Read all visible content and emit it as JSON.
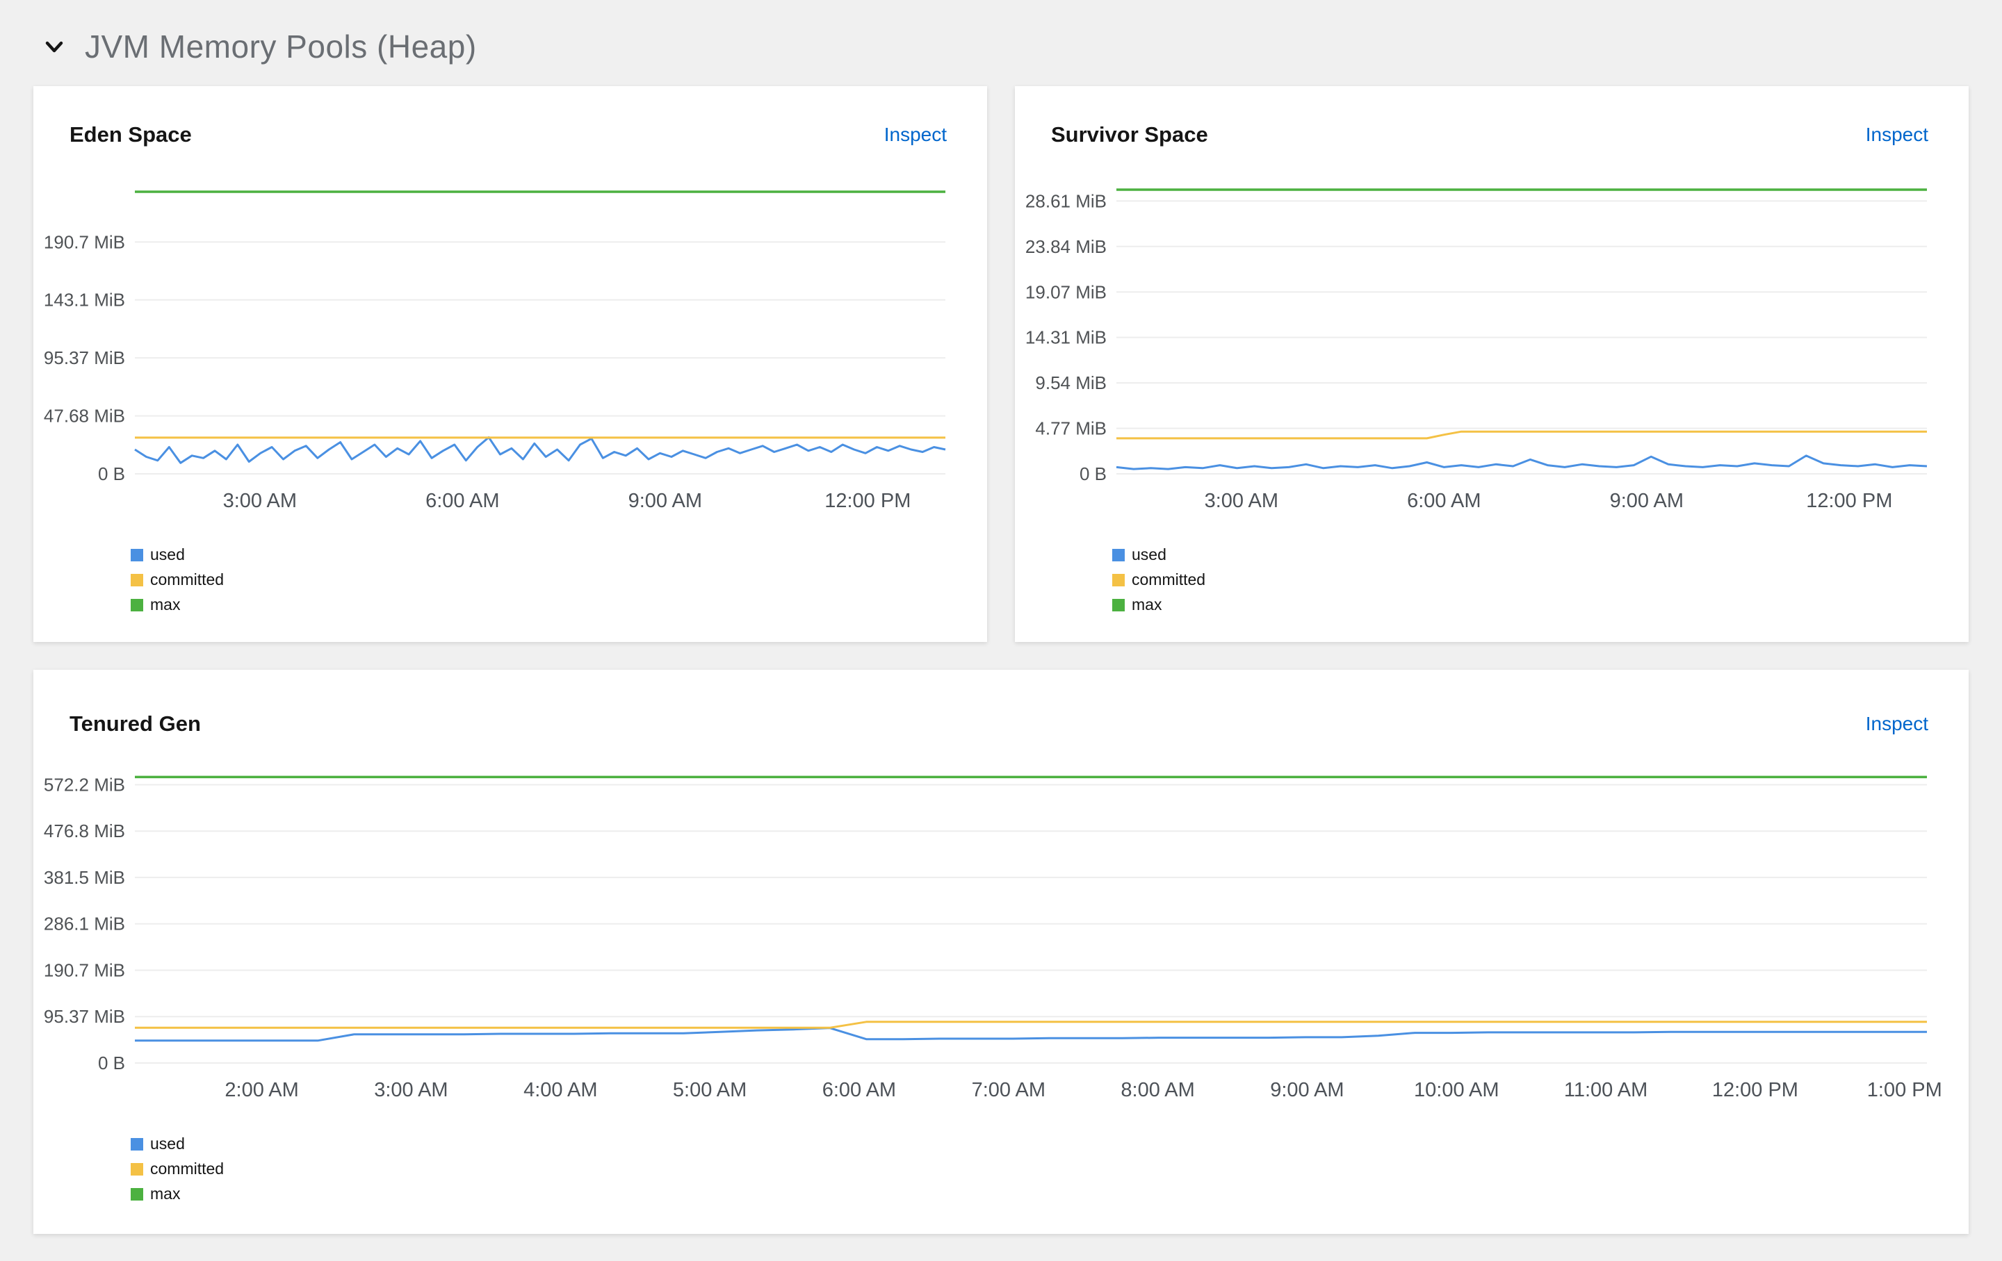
{
  "header": {
    "title": "JVM Memory Pools (Heap)"
  },
  "labels": {
    "inspect": "Inspect"
  },
  "colors": {
    "used": "#4a90e2",
    "committed": "#f4c145",
    "max": "#4cb140",
    "link": "#0066cc",
    "grid": "#ededed"
  },
  "legend": [
    {
      "label": "used",
      "color_key": "used"
    },
    {
      "label": "committed",
      "color_key": "committed"
    },
    {
      "label": "max",
      "color_key": "max"
    }
  ],
  "chart_data": [
    {
      "type": "line",
      "name": "eden-space",
      "title": "Eden Space",
      "x_domain": [
        1.15,
        13.15
      ],
      "y_max": 240,
      "ylabel": "",
      "xlabel": "",
      "grid": true,
      "legend_position": "bottom-left",
      "y_ticks": [
        {
          "value": 0,
          "label": "0 B"
        },
        {
          "value": 47.68,
          "label": "47.68 MiB"
        },
        {
          "value": 95.37,
          "label": "95.37 MiB"
        },
        {
          "value": 143.1,
          "label": "143.1 MiB"
        },
        {
          "value": 190.7,
          "label": "190.7 MiB"
        }
      ],
      "x_ticks": [
        {
          "t": 3,
          "label": "3:00 AM"
        },
        {
          "t": 6,
          "label": "6:00 AM"
        },
        {
          "t": 9,
          "label": "9:00 AM"
        },
        {
          "t": 12,
          "label": "12:00 PM"
        }
      ],
      "series": [
        {
          "name": "used",
          "color_key": "used",
          "values": [
            20,
            14,
            11,
            22,
            9,
            15,
            13,
            19,
            12,
            24,
            10,
            17,
            22,
            12,
            19,
            23,
            13,
            20,
            26,
            12,
            18,
            24,
            14,
            21,
            16,
            27,
            13,
            19,
            24,
            11,
            22,
            30,
            16,
            21,
            12,
            25,
            14,
            20,
            11,
            24,
            29,
            13,
            18,
            15,
            21,
            12,
            17,
            14,
            19,
            16,
            13,
            18,
            21,
            17,
            20,
            23,
            18,
            21,
            24,
            19,
            22,
            18,
            24,
            20,
            17,
            22,
            19,
            23,
            20,
            18,
            22,
            20
          ]
        },
        {
          "name": "committed",
          "color_key": "committed",
          "value": 29.8
        },
        {
          "name": "max",
          "color_key": "max",
          "value": 232
        }
      ]
    },
    {
      "type": "line",
      "name": "survivor-space",
      "title": "Survivor Space",
      "x_domain": [
        1.15,
        13.15
      ],
      "y_max": 30.6,
      "ylabel": "",
      "xlabel": "",
      "grid": true,
      "legend_position": "bottom-left",
      "y_ticks": [
        {
          "value": 0,
          "label": "0 B"
        },
        {
          "value": 4.77,
          "label": "4.77 MiB"
        },
        {
          "value": 9.54,
          "label": "9.54 MiB"
        },
        {
          "value": 14.31,
          "label": "14.31 MiB"
        },
        {
          "value": 19.07,
          "label": "19.07 MiB"
        },
        {
          "value": 23.84,
          "label": "23.84 MiB"
        },
        {
          "value": 28.61,
          "label": "28.61 MiB"
        }
      ],
      "x_ticks": [
        {
          "t": 3,
          "label": "3:00 AM"
        },
        {
          "t": 6,
          "label": "6:00 AM"
        },
        {
          "t": 9,
          "label": "9:00 AM"
        },
        {
          "t": 12,
          "label": "12:00 PM"
        }
      ],
      "series": [
        {
          "name": "used",
          "color_key": "used",
          "values": [
            0.7,
            0.5,
            0.6,
            0.5,
            0.7,
            0.6,
            0.9,
            0.6,
            0.8,
            0.6,
            0.7,
            1.0,
            0.6,
            0.8,
            0.7,
            0.9,
            0.6,
            0.8,
            1.2,
            0.7,
            0.9,
            0.7,
            1.0,
            0.8,
            1.5,
            0.9,
            0.7,
            1.0,
            0.8,
            0.7,
            0.9,
            1.8,
            1.0,
            0.8,
            0.7,
            0.9,
            0.8,
            1.1,
            0.9,
            0.8,
            1.9,
            1.1,
            0.9,
            0.8,
            1.0,
            0.7,
            0.9,
            0.8
          ]
        },
        {
          "name": "committed",
          "color_key": "committed",
          "values": [
            3.72,
            3.72,
            3.72,
            3.72,
            3.72,
            3.72,
            3.72,
            3.72,
            3.72,
            3.72,
            3.72,
            3.72,
            3.72,
            3.72,
            3.72,
            3.72,
            3.72,
            3.72,
            3.72,
            4.1,
            4.43,
            4.43,
            4.43,
            4.43,
            4.43,
            4.43,
            4.43,
            4.43,
            4.43,
            4.43,
            4.43,
            4.43,
            4.43,
            4.43,
            4.43,
            4.43,
            4.43,
            4.43,
            4.43,
            4.43,
            4.43,
            4.43,
            4.43,
            4.43,
            4.43,
            4.43,
            4.43,
            4.43
          ]
        },
        {
          "name": "max",
          "color_key": "max",
          "value": 29.8
        }
      ]
    },
    {
      "type": "line",
      "name": "tenured-gen",
      "title": "Tenured Gen",
      "x_domain": [
        1.15,
        13.15
      ],
      "y_max": 600,
      "ylabel": "",
      "xlabel": "",
      "grid": true,
      "legend_position": "bottom-left",
      "y_ticks": [
        {
          "value": 0,
          "label": "0 B"
        },
        {
          "value": 95.37,
          "label": "95.37 MiB"
        },
        {
          "value": 190.7,
          "label": "190.7 MiB"
        },
        {
          "value": 286.1,
          "label": "286.1 MiB"
        },
        {
          "value": 381.5,
          "label": "381.5 MiB"
        },
        {
          "value": 476.8,
          "label": "476.8 MiB"
        },
        {
          "value": 572.2,
          "label": "572.2 MiB"
        }
      ],
      "x_ticks": [
        {
          "t": 2,
          "label": "2:00 AM"
        },
        {
          "t": 3,
          "label": "3:00 AM"
        },
        {
          "t": 4,
          "label": "4:00 AM"
        },
        {
          "t": 5,
          "label": "5:00 AM"
        },
        {
          "t": 6,
          "label": "6:00 AM"
        },
        {
          "t": 7,
          "label": "7:00 AM"
        },
        {
          "t": 8,
          "label": "8:00 AM"
        },
        {
          "t": 9,
          "label": "9:00 AM"
        },
        {
          "t": 10,
          "label": "10:00 AM"
        },
        {
          "t": 11,
          "label": "11:00 AM"
        },
        {
          "t": 12,
          "label": "12:00 PM"
        },
        {
          "t": 13,
          "label": "1:00 PM"
        }
      ],
      "series": [
        {
          "name": "used",
          "color_key": "used",
          "values": [
            46,
            46,
            46,
            46,
            46,
            46,
            59,
            59,
            59,
            59,
            60,
            60,
            60,
            61,
            61,
            61,
            64,
            67,
            69,
            72,
            49,
            49,
            50,
            50,
            50,
            51,
            51,
            51,
            52,
            52,
            52,
            52,
            53,
            53,
            56,
            62,
            62,
            63,
            63,
            63,
            63,
            63,
            64,
            64,
            64,
            64,
            64,
            64,
            64,
            64
          ]
        },
        {
          "name": "committed",
          "color_key": "committed",
          "values": [
            72.5,
            72.5,
            72.5,
            72.5,
            72.5,
            72.5,
            72.5,
            72.5,
            72.5,
            72.5,
            72.5,
            72.5,
            72.5,
            72.5,
            72.5,
            72.5,
            72.5,
            72.5,
            72.5,
            72.5,
            84.5,
            84.5,
            84.5,
            84.5,
            84.5,
            84.5,
            84.5,
            84.5,
            84.5,
            84.5,
            84.5,
            84.5,
            84.5,
            84.5,
            84.5,
            84.5,
            84.5,
            84.5,
            84.5,
            84.5,
            84.5,
            84.5,
            84.5,
            84.5,
            84.5,
            84.5,
            84.5,
            84.5,
            84.5,
            84.5
          ]
        },
        {
          "name": "max",
          "color_key": "max",
          "value": 588
        }
      ]
    }
  ]
}
